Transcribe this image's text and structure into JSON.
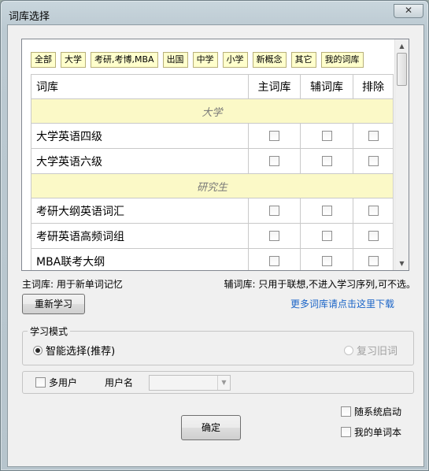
{
  "window": {
    "title": "词库选择",
    "close_glyph": "✕"
  },
  "filters": [
    "全部",
    "大学",
    "考研,考博,MBA",
    "出国",
    "中学",
    "小学",
    "新概念",
    "其它",
    "我的词库"
  ],
  "table": {
    "headers": {
      "name": "词库",
      "main": "主词库",
      "aux": "辅词库",
      "exclude": "排除"
    },
    "groups": [
      {
        "title": "大学",
        "items": [
          "大学英语四级",
          "大学英语六级"
        ]
      },
      {
        "title": "研究生",
        "items": [
          "考研大纲英语词汇",
          "考研英语高频词组",
          "MBA联考大纲"
        ]
      }
    ]
  },
  "notes": {
    "main": "主词库: 用于新单词记忆",
    "aux": "辅词库: 只用于联想,不进入学习序列,可不选。"
  },
  "buttons": {
    "relearn": "重新学习",
    "ok": "确定"
  },
  "links": {
    "download": "更多词库请点击这里下载"
  },
  "mode": {
    "legend": "学习模式",
    "smart": "智能选择(推荐)",
    "review": "复习旧词",
    "selected": "smart"
  },
  "user": {
    "multi_user": "多用户",
    "username_label": "用户名",
    "username_value": ""
  },
  "options": {
    "autostart": "随系统启动",
    "wordbook": "我的单词本"
  }
}
